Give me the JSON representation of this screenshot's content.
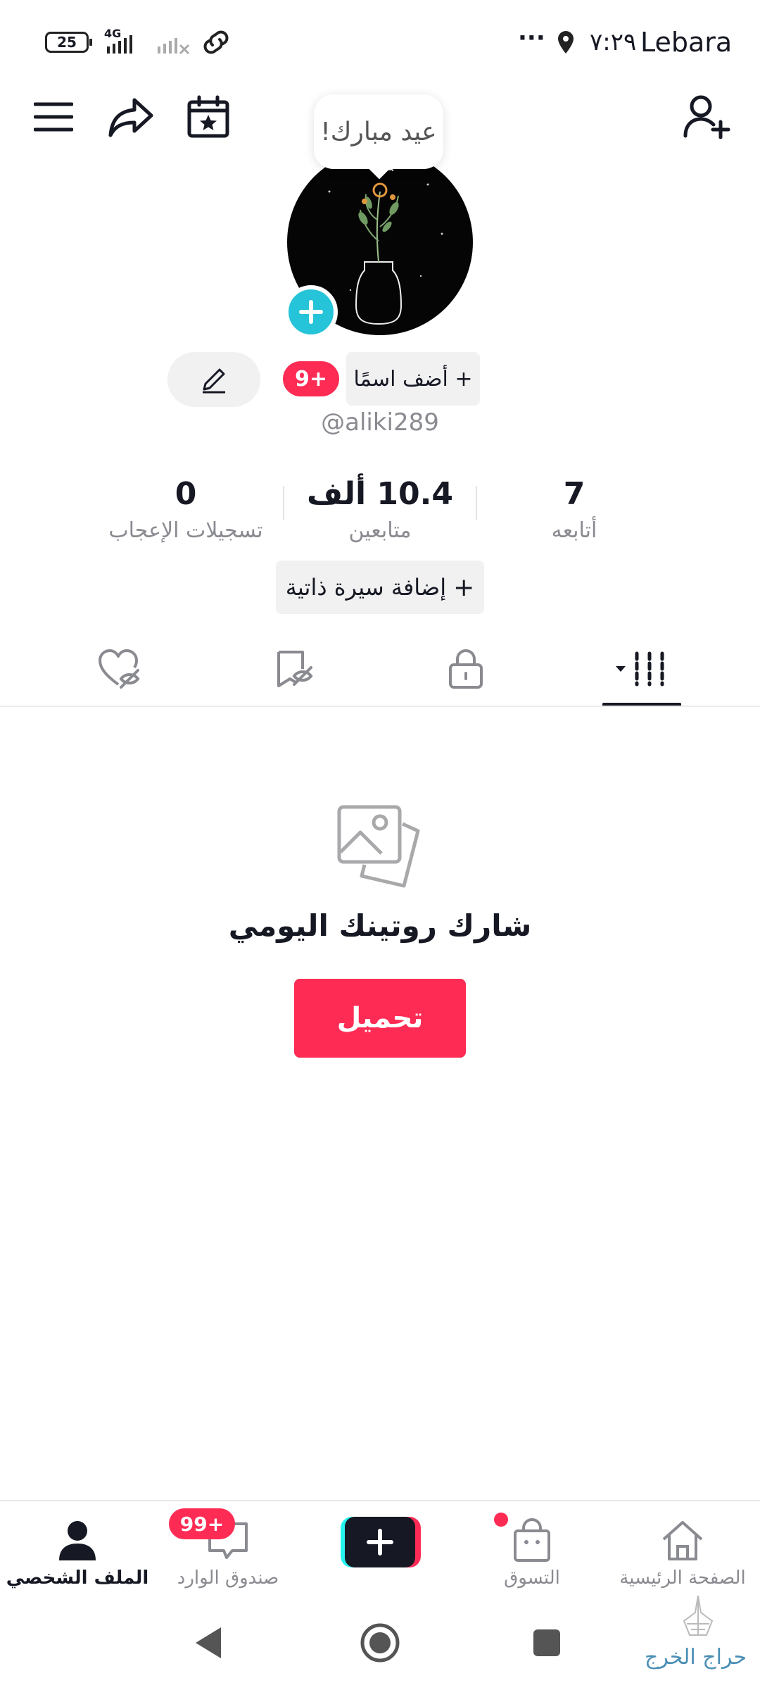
{
  "status_bar": {
    "carrier": "Lebara",
    "time": "٧:٢٩",
    "battery": "25",
    "network": "4G",
    "more": "···"
  },
  "profile": {
    "greeting_bubble": "عيد مبارك!",
    "add_name_label": "+ أضف اسمًا",
    "notification_badge": "9+",
    "username": "@aliki289",
    "add_bio_label": "إضافة سيرة ذاتية",
    "add_bio_plus": "+"
  },
  "stats": {
    "following": {
      "value": "7",
      "label": "أتابعه"
    },
    "followers": {
      "value": "10.4 ألف",
      "label": "متابعين"
    },
    "likes": {
      "value": "0",
      "label": "تسجيلات الإعجاب"
    }
  },
  "tabs": [
    {
      "name": "videos",
      "icon": "grid-icon",
      "active": true
    },
    {
      "name": "private",
      "icon": "lock-icon",
      "active": false
    },
    {
      "name": "reposts",
      "icon": "repost-hidden-icon",
      "active": false
    },
    {
      "name": "liked",
      "icon": "heart-hidden-icon",
      "active": false
    }
  ],
  "empty_state": {
    "title": "شارك روتينك اليومي",
    "button": "تحميل"
  },
  "bottom_nav": {
    "home": "الصفحة الرئيسية",
    "shop": "التسوق",
    "inbox": "صندوق الوارد",
    "inbox_badge": "99+",
    "profile": "الملف الشخصي"
  },
  "watermark": "حراج الخرج",
  "colors": {
    "accent": "#fe2c55",
    "teal": "#25c4d8",
    "text": "#161823",
    "secondary_text": "#8a8b91",
    "chip_bg": "#f1f1f2"
  }
}
